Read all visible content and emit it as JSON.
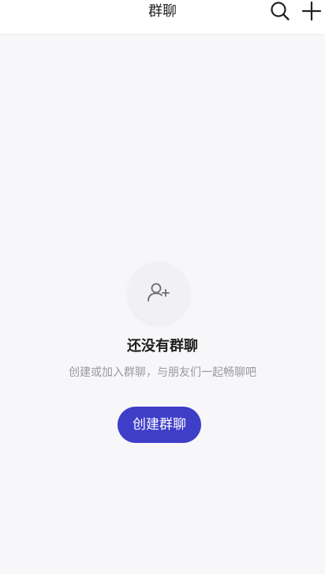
{
  "header": {
    "title": "群聊",
    "search_icon": "search-icon",
    "add_icon": "plus-icon"
  },
  "empty_state": {
    "icon": "add-user-icon",
    "title": "还没有群聊",
    "subtitle": "创建或加入群聊，与朋友们一起畅聊吧",
    "button_label": "创建群聊"
  },
  "colors": {
    "accent": "#3f3ec9",
    "background": "#f7f7f9",
    "subtitle": "#9a9a9e"
  }
}
